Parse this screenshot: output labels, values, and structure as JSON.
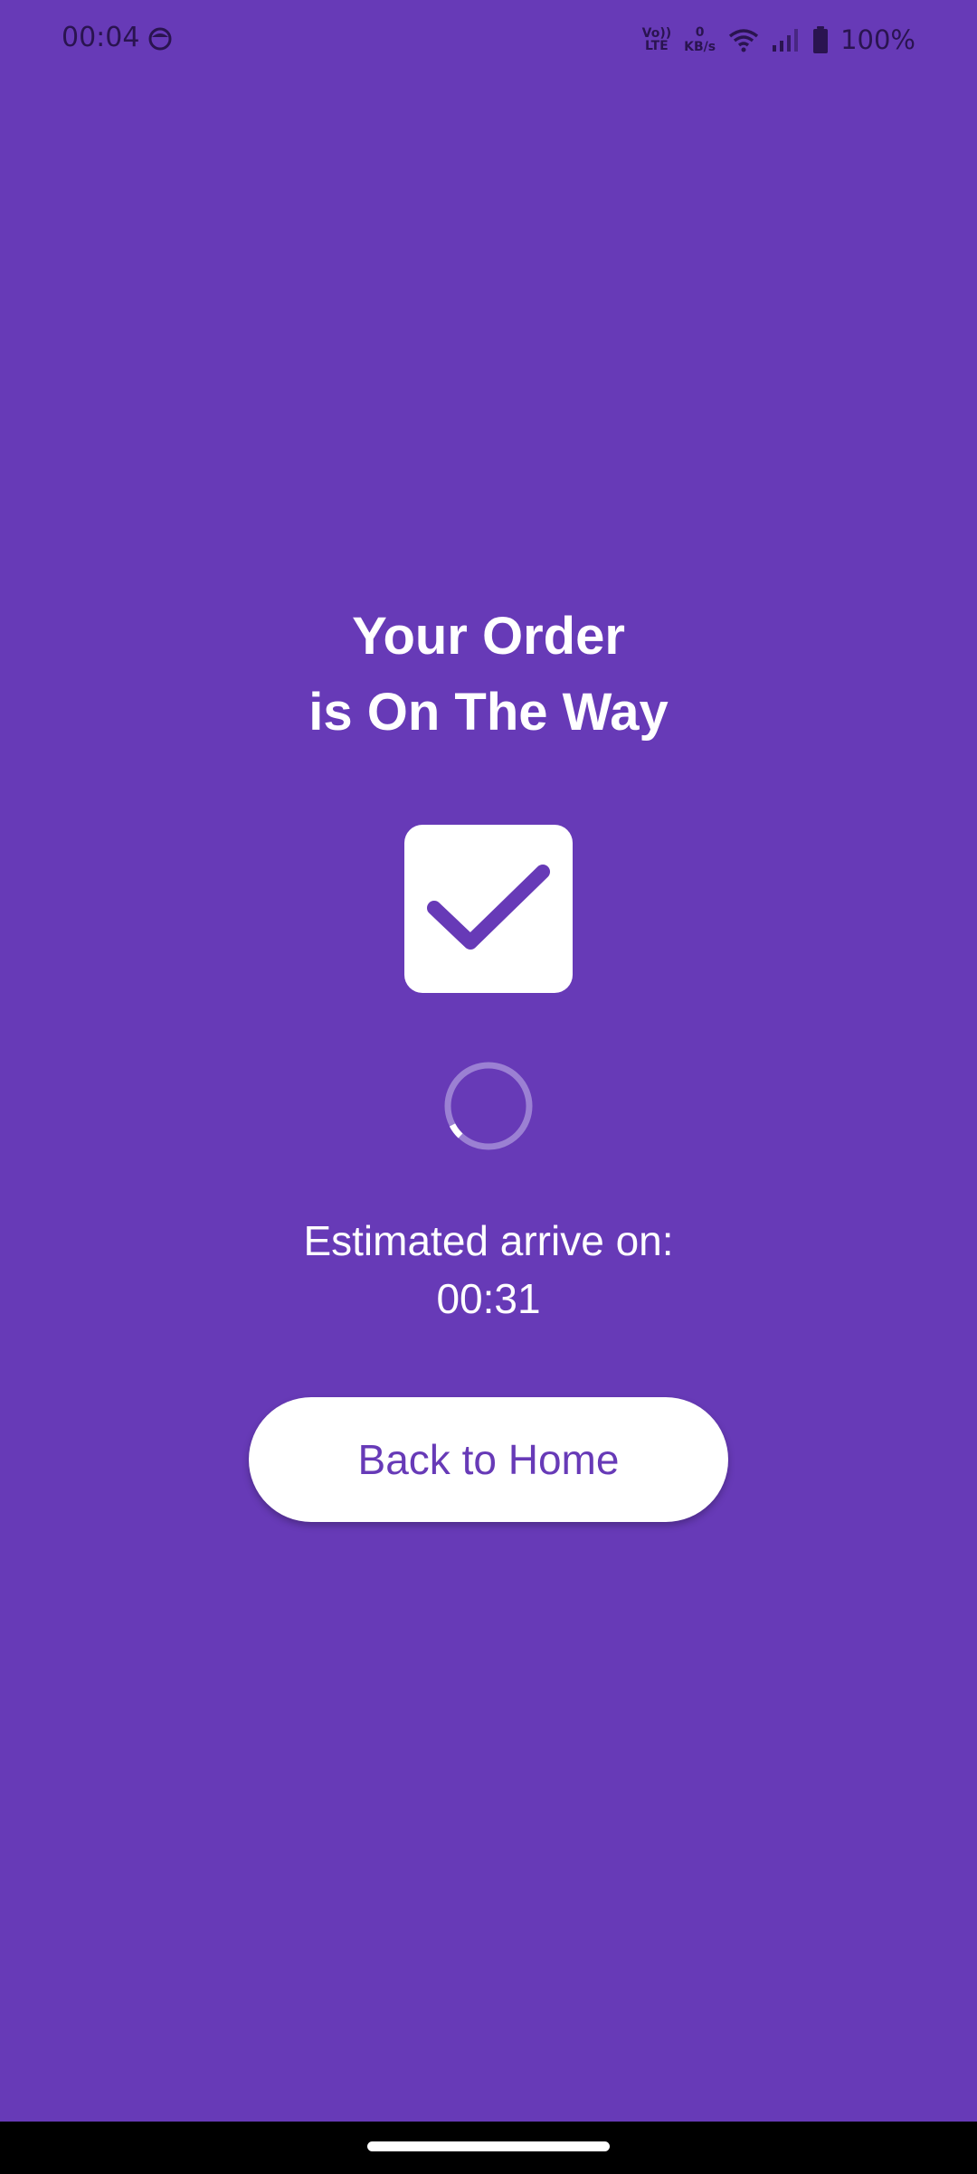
{
  "status_bar": {
    "time": "00:04",
    "network_label": "Vo))\nLTE",
    "data_speed_value": "0",
    "data_speed_unit": "KB/s",
    "battery": "100%"
  },
  "order": {
    "title_line1": "Your Order",
    "title_line2": "is On The Way",
    "eta_label": "Estimated arrive on:",
    "eta_time": "00:31"
  },
  "actions": {
    "home_label": "Back to Home"
  },
  "colors": {
    "background": "#673AB7",
    "surface": "#FFFFFF",
    "accent": "#673AB7"
  },
  "icons": {
    "status": [
      "face-icon",
      "volte-icon",
      "wifi-icon",
      "signal-icon",
      "battery-icon"
    ],
    "main": [
      "checkbox-checked-icon",
      "loading-spinner"
    ]
  }
}
